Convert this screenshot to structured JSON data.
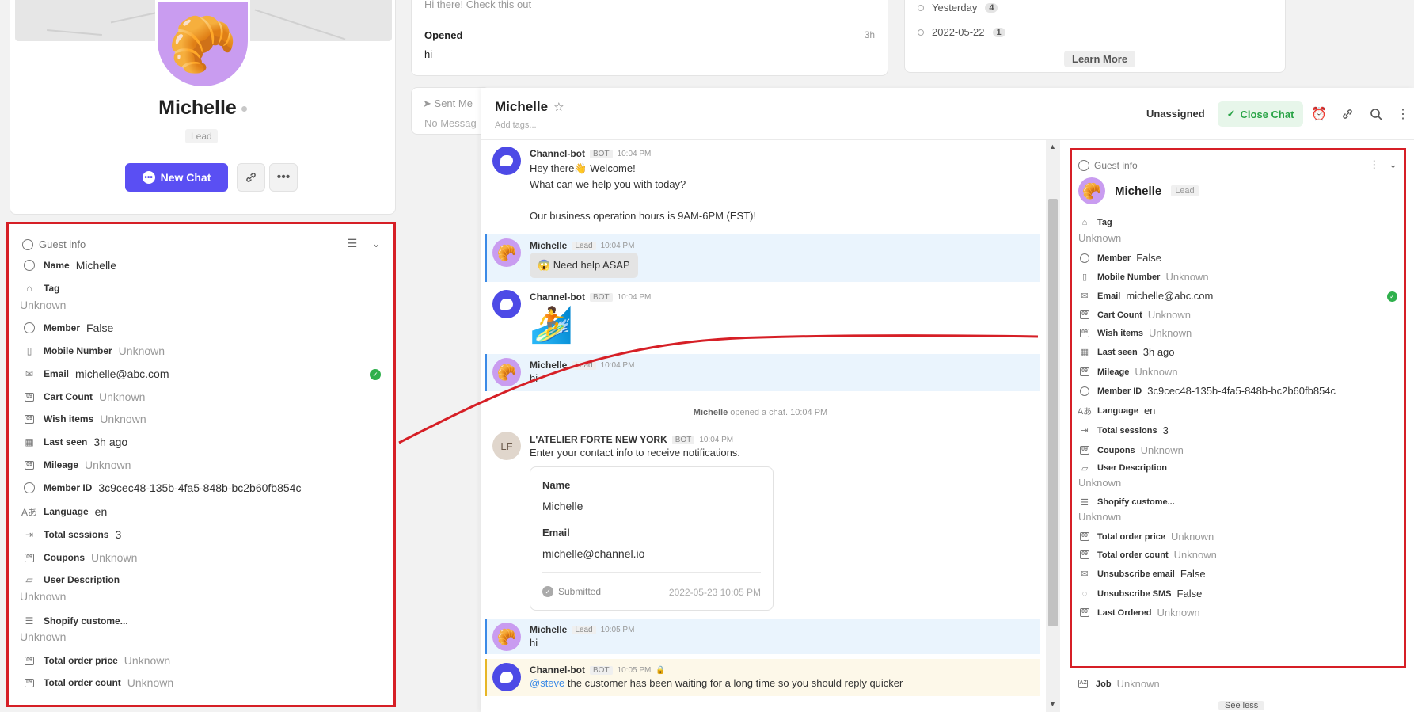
{
  "profile": {
    "name": "Michelle",
    "badge": "Lead",
    "avatar_emoji": "🥐",
    "new_chat_label": "New Chat",
    "link_icon": "link-icon",
    "more_icon": "more-icon"
  },
  "guest_left": {
    "title": "Guest info",
    "fields": [
      {
        "label": "Name",
        "value": "Michelle"
      },
      {
        "label": "Tag",
        "value": "Unknown"
      },
      {
        "label": "Member",
        "value": "False"
      },
      {
        "label": "Mobile Number",
        "value": "Unknown"
      },
      {
        "label": "Email",
        "value": "michelle@abc.com"
      },
      {
        "label": "Cart Count",
        "value": "Unknown"
      },
      {
        "label": "Wish items",
        "value": "Unknown"
      },
      {
        "label": "Last seen",
        "value": "3h ago"
      },
      {
        "label": "Mileage",
        "value": "Unknown"
      },
      {
        "label": "Member ID",
        "value": "3c9cec48-135b-4fa5-848b-bc2b60fb854c"
      },
      {
        "label": "Language",
        "value": "en"
      },
      {
        "label": "Total sessions",
        "value": "3"
      },
      {
        "label": "Coupons",
        "value": "Unknown"
      },
      {
        "label": "User Description",
        "value": "Unknown"
      },
      {
        "label": "Shopify custome...",
        "value": "Unknown"
      },
      {
        "label": "Total order price",
        "value": "Unknown"
      },
      {
        "label": "Total order count",
        "value": "Unknown"
      }
    ]
  },
  "opened_card": {
    "preview": "Hi there! Check this out",
    "title": "Opened",
    "time": "3h",
    "message": "hi"
  },
  "sent_card": {
    "title": "Sent Me",
    "subtitle": "No Messag"
  },
  "history": {
    "rows": [
      {
        "label": "Yesterday",
        "count": "4"
      },
      {
        "label": "2022-05-22",
        "count": "1"
      }
    ],
    "learn_more": "Learn More"
  },
  "chat": {
    "title": "Michelle",
    "add_tags": "Add tags...",
    "unassigned": "Unassigned",
    "close_chat": "Close Chat",
    "messages": {
      "m1": {
        "name": "Channel-bot",
        "tag": "BOT",
        "time": "10:04 PM",
        "l1": "Hey there👋 Welcome!",
        "l2": "What can we help you with today?",
        "l3": "Our business operation hours is 9AM-6PM (EST)!"
      },
      "m2": {
        "name": "Michelle",
        "tag": "Lead",
        "time": "10:04 PM",
        "text": "😱 Need help ASAP"
      },
      "m3": {
        "name": "Channel-bot",
        "tag": "BOT",
        "time": "10:04 PM",
        "emoji": "🏄"
      },
      "m4": {
        "name": "Michelle",
        "tag": "Lead",
        "time": "10:04 PM",
        "text": "hi"
      },
      "sys": {
        "name": "Michelle",
        "text": "opened a chat.",
        "time": "10:04 PM"
      },
      "m5": {
        "name": "L'ATELIER FORTE NEW YORK",
        "tag": "BOT",
        "time": "10:04 PM",
        "text": "Enter your contact info to receive notifications."
      },
      "form": {
        "name_label": "Name",
        "name_value": "Michelle",
        "email_label": "Email",
        "email_value": "michelle@channel.io",
        "status": "Submitted",
        "date": "2022-05-23 10:05 PM"
      },
      "m6": {
        "name": "Michelle",
        "tag": "Lead",
        "time": "10:05 PM",
        "text": "hi"
      },
      "m7": {
        "name": "Channel-bot",
        "tag": "BOT",
        "time": "10:05 PM",
        "mention": "@steve",
        "text": " the customer has been waiting for a long time so you should reply quicker"
      }
    }
  },
  "guest_right": {
    "title": "Guest info",
    "name": "Michelle",
    "badge": "Lead",
    "fields": [
      {
        "label": "Tag",
        "value": "Unknown"
      },
      {
        "label": "Member",
        "value": "False"
      },
      {
        "label": "Mobile Number",
        "value": "Unknown"
      },
      {
        "label": "Email",
        "value": "michelle@abc.com"
      },
      {
        "label": "Cart Count",
        "value": "Unknown"
      },
      {
        "label": "Wish items",
        "value": "Unknown"
      },
      {
        "label": "Last seen",
        "value": "3h ago"
      },
      {
        "label": "Mileage",
        "value": "Unknown"
      },
      {
        "label": "Member ID",
        "value": "3c9cec48-135b-4fa5-848b-bc2b60fb854c"
      },
      {
        "label": "Language",
        "value": "en"
      },
      {
        "label": "Total sessions",
        "value": "3"
      },
      {
        "label": "Coupons",
        "value": "Unknown"
      },
      {
        "label": "User Description",
        "value": "Unknown"
      },
      {
        "label": "Shopify custome...",
        "value": "Unknown"
      },
      {
        "label": "Total order price",
        "value": "Unknown"
      },
      {
        "label": "Total order count",
        "value": "Unknown"
      },
      {
        "label": "Unsubscribe email",
        "value": "False"
      },
      {
        "label": "Unsubscribe SMS",
        "value": "False"
      },
      {
        "label": "Last Ordered",
        "value": "Unknown"
      }
    ],
    "job": {
      "label": "Job",
      "value": "Unknown"
    },
    "see_less": "See less"
  },
  "colors": {
    "accent": "#5a4ff3",
    "highlight": "#d61f26",
    "success": "#2fb04c"
  }
}
